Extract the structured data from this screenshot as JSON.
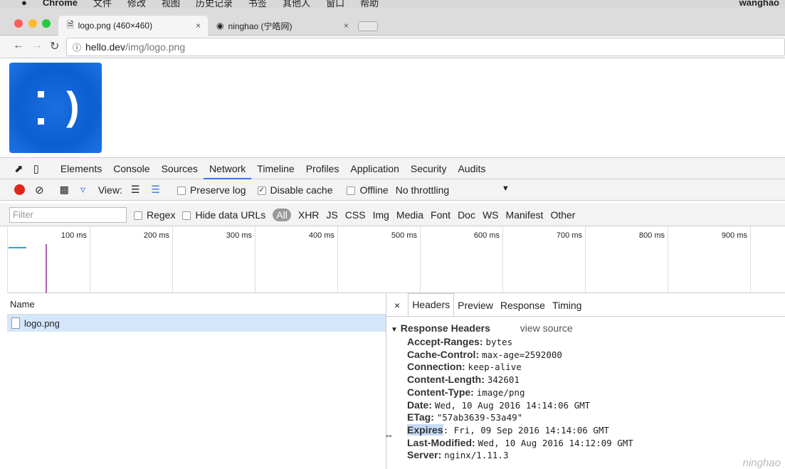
{
  "menubar": {
    "apple": "",
    "app": "Chrome",
    "items": [
      "文件",
      "修改",
      "视图",
      "历史记录",
      "书签",
      "其他人",
      "窗口",
      "帮助"
    ],
    "user": "wanghao"
  },
  "tabs": [
    {
      "title": "logo.png (460×460)",
      "close": "×"
    },
    {
      "title": "ninghao (宁皓网)",
      "close": "×"
    }
  ],
  "address": {
    "host": "hello.dev",
    "path": "/img/logo.png"
  },
  "devtools": {
    "tabs": [
      "Elements",
      "Console",
      "Sources",
      "Network",
      "Timeline",
      "Profiles",
      "Application",
      "Security",
      "Audits"
    ],
    "active_tab": "Network",
    "toolbar": {
      "view_label": "View:",
      "preserve_log": "Preserve log",
      "disable_cache": "Disable cache",
      "disable_cache_checked": true,
      "offline": "Offline",
      "throttling": "No throttling"
    },
    "filter": {
      "placeholder": "Filter",
      "regex": "Regex",
      "hide_data_urls": "Hide data URLs",
      "types": [
        "All",
        "XHR",
        "JS",
        "CSS",
        "Img",
        "Media",
        "Font",
        "Doc",
        "WS",
        "Manifest",
        "Other"
      ],
      "active_type": "All"
    },
    "timeline_ticks": [
      "100 ms",
      "200 ms",
      "300 ms",
      "400 ms",
      "500 ms",
      "600 ms",
      "700 ms",
      "800 ms",
      "900 ms"
    ],
    "requests": {
      "header": "Name",
      "rows": [
        {
          "name": "logo.png"
        }
      ]
    },
    "detail": {
      "close": "×",
      "tabs": [
        "Headers",
        "Preview",
        "Response",
        "Timing"
      ],
      "active_tab": "Headers",
      "section": "Response Headers",
      "view_source": "view source",
      "headers": [
        {
          "k": "Accept-Ranges:",
          "v": "bytes"
        },
        {
          "k": "Cache-Control:",
          "v": "max-age=2592000"
        },
        {
          "k": "Connection:",
          "v": "keep-alive"
        },
        {
          "k": "Content-Length:",
          "v": "342601"
        },
        {
          "k": "Content-Type:",
          "v": "image/png"
        },
        {
          "k": "Date:",
          "v": "Wed, 10 Aug 2016 14:14:06 GMT"
        },
        {
          "k": "ETag:",
          "v": "\"57ab3639-53a49\""
        },
        {
          "k": "Expires",
          "v": ": Fri, 09 Sep 2016 14:14:06 GMT"
        },
        {
          "k": "Last-Modified:",
          "v": "Wed, 10 Aug 2016 14:12:09 GMT"
        },
        {
          "k": "Server:",
          "v": "nginx/1.11.3"
        }
      ]
    }
  },
  "watermark": "ninghao"
}
